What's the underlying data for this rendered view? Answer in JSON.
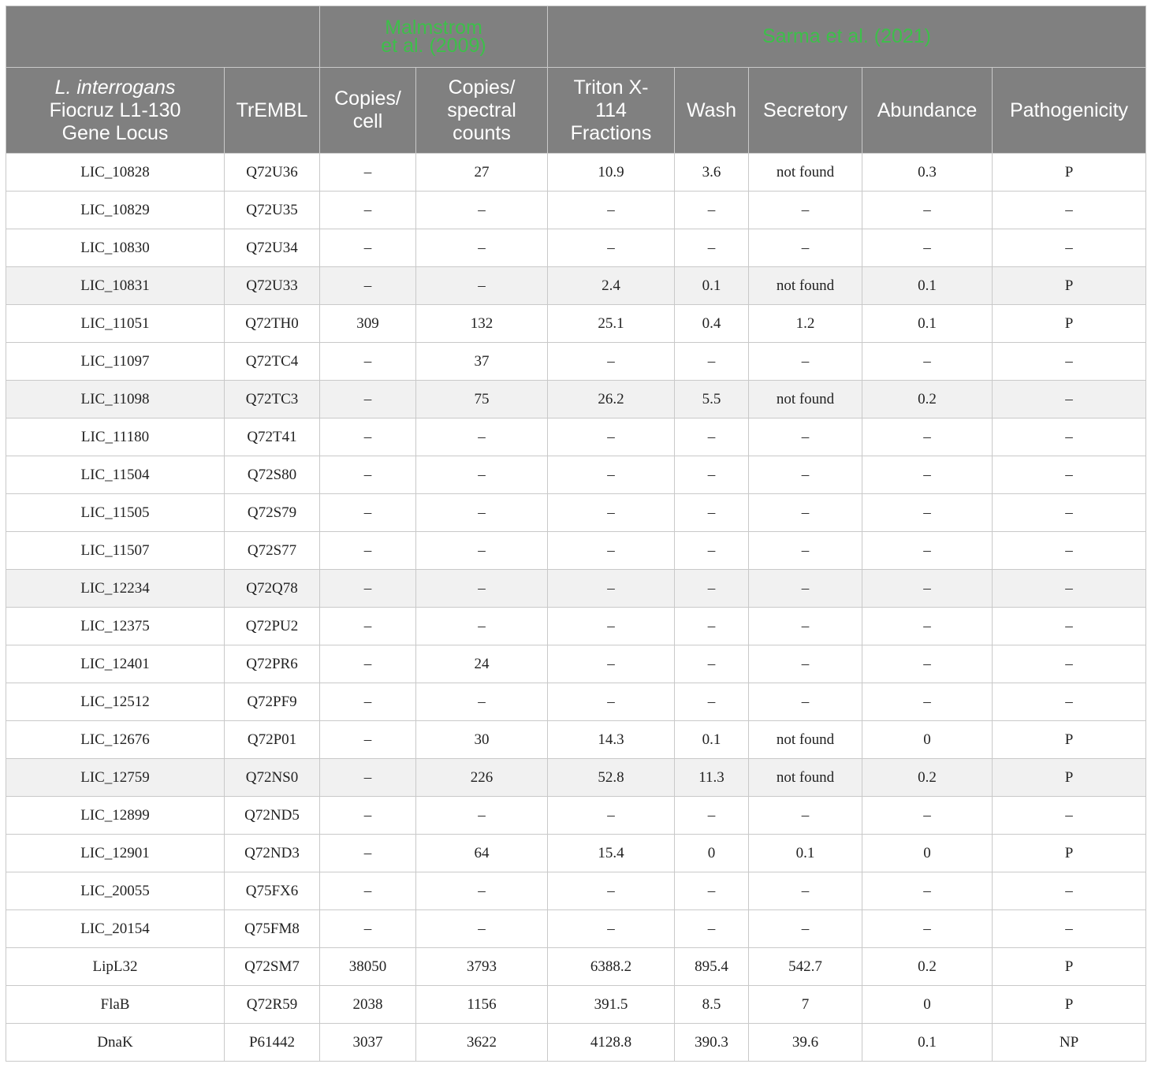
{
  "group_headers": {
    "blank": "",
    "malmstrom_line1": "Malmstrom",
    "malmstrom_line2": "et al. (2009)",
    "sarma": "Sarma et al. (2021)"
  },
  "columns": {
    "locus": [
      "L. interrogans",
      "Fiocruz L1-130",
      "Gene Locus"
    ],
    "trembl": "TrEMBL",
    "copies_cell": [
      "Copies/",
      "cell"
    ],
    "copies_spectral": [
      "Copies/",
      "spectral",
      "counts"
    ],
    "triton": [
      "Triton X-",
      "114",
      "Fractions"
    ],
    "wash": "Wash",
    "secretory": "Secretory",
    "abundance": "Abundance",
    "pathogenicity": "Pathogenicity"
  },
  "rows": [
    {
      "locus": "LIC_10828",
      "trembl": "Q72U36",
      "copies_cell": "–",
      "copies_spectral": "27",
      "triton": "10.9",
      "wash": "3.6",
      "secretory": "not found",
      "abundance": "0.3",
      "pathogenicity": "P",
      "shaded": false
    },
    {
      "locus": "LIC_10829",
      "trembl": "Q72U35",
      "copies_cell": "–",
      "copies_spectral": "–",
      "triton": "–",
      "wash": "–",
      "secretory": "–",
      "abundance": "–",
      "pathogenicity": "–",
      "shaded": false
    },
    {
      "locus": "LIC_10830",
      "trembl": "Q72U34",
      "copies_cell": "–",
      "copies_spectral": "–",
      "triton": "–",
      "wash": "–",
      "secretory": "–",
      "abundance": "–",
      "pathogenicity": "–",
      "shaded": false
    },
    {
      "locus": "LIC_10831",
      "trembl": "Q72U33",
      "copies_cell": "–",
      "copies_spectral": "–",
      "triton": "2.4",
      "wash": "0.1",
      "secretory": "not found",
      "abundance": "0.1",
      "pathogenicity": "P",
      "shaded": true
    },
    {
      "locus": "LIC_11051",
      "trembl": "Q72TH0",
      "copies_cell": "309",
      "copies_spectral": "132",
      "triton": "25.1",
      "wash": "0.4",
      "secretory": "1.2",
      "abundance": "0.1",
      "pathogenicity": "P",
      "shaded": false
    },
    {
      "locus": "LIC_11097",
      "trembl": "Q72TC4",
      "copies_cell": "–",
      "copies_spectral": "37",
      "triton": "–",
      "wash": "–",
      "secretory": "–",
      "abundance": "–",
      "pathogenicity": "–",
      "shaded": false
    },
    {
      "locus": "LIC_11098",
      "trembl": "Q72TC3",
      "copies_cell": "–",
      "copies_spectral": "75",
      "triton": "26.2",
      "wash": "5.5",
      "secretory": "not found",
      "abundance": "0.2",
      "pathogenicity": "–",
      "shaded": true
    },
    {
      "locus": "LIC_11180",
      "trembl": "Q72T41",
      "copies_cell": "–",
      "copies_spectral": "–",
      "triton": "–",
      "wash": "–",
      "secretory": "–",
      "abundance": "–",
      "pathogenicity": "–",
      "shaded": false
    },
    {
      "locus": "LIC_11504",
      "trembl": "Q72S80",
      "copies_cell": "–",
      "copies_spectral": "–",
      "triton": "–",
      "wash": "–",
      "secretory": "–",
      "abundance": "–",
      "pathogenicity": "–",
      "shaded": false
    },
    {
      "locus": "LIC_11505",
      "trembl": "Q72S79",
      "copies_cell": "–",
      "copies_spectral": "–",
      "triton": "–",
      "wash": "–",
      "secretory": "–",
      "abundance": "–",
      "pathogenicity": "–",
      "shaded": false
    },
    {
      "locus": "LIC_11507",
      "trembl": "Q72S77",
      "copies_cell": "–",
      "copies_spectral": "–",
      "triton": "–",
      "wash": "–",
      "secretory": "–",
      "abundance": "–",
      "pathogenicity": "–",
      "shaded": false
    },
    {
      "locus": "LIC_12234",
      "trembl": "Q72Q78",
      "copies_cell": "–",
      "copies_spectral": "–",
      "triton": "–",
      "wash": "–",
      "secretory": "–",
      "abundance": "–",
      "pathogenicity": "–",
      "shaded": true
    },
    {
      "locus": "LIC_12375",
      "trembl": "Q72PU2",
      "copies_cell": "–",
      "copies_spectral": "–",
      "triton": "–",
      "wash": "–",
      "secretory": "–",
      "abundance": "–",
      "pathogenicity": "–",
      "shaded": false
    },
    {
      "locus": "LIC_12401",
      "trembl": "Q72PR6",
      "copies_cell": "–",
      "copies_spectral": "24",
      "triton": "–",
      "wash": "–",
      "secretory": "–",
      "abundance": "–",
      "pathogenicity": "–",
      "shaded": false
    },
    {
      "locus": "LIC_12512",
      "trembl": "Q72PF9",
      "copies_cell": "–",
      "copies_spectral": "–",
      "triton": "–",
      "wash": "–",
      "secretory": "–",
      "abundance": "–",
      "pathogenicity": "–",
      "shaded": false
    },
    {
      "locus": "LIC_12676",
      "trembl": "Q72P01",
      "copies_cell": "–",
      "copies_spectral": "30",
      "triton": "14.3",
      "wash": "0.1",
      "secretory": "not found",
      "abundance": "0",
      "pathogenicity": "P",
      "shaded": false
    },
    {
      "locus": "LIC_12759",
      "trembl": "Q72NS0",
      "copies_cell": "–",
      "copies_spectral": "226",
      "triton": "52.8",
      "wash": "11.3",
      "secretory": "not found",
      "abundance": "0.2",
      "pathogenicity": "P",
      "shaded": true
    },
    {
      "locus": "LIC_12899",
      "trembl": "Q72ND5",
      "copies_cell": "–",
      "copies_spectral": "–",
      "triton": "–",
      "wash": "–",
      "secretory": "–",
      "abundance": "–",
      "pathogenicity": "–",
      "shaded": false
    },
    {
      "locus": "LIC_12901",
      "trembl": "Q72ND3",
      "copies_cell": "–",
      "copies_spectral": "64",
      "triton": "15.4",
      "wash": "0",
      "secretory": "0.1",
      "abundance": "0",
      "pathogenicity": "P",
      "shaded": false
    },
    {
      "locus": "LIC_20055",
      "trembl": "Q75FX6",
      "copies_cell": "–",
      "copies_spectral": "–",
      "triton": "–",
      "wash": "–",
      "secretory": "–",
      "abundance": "–",
      "pathogenicity": "–",
      "shaded": false
    },
    {
      "locus": "LIC_20154",
      "trembl": "Q75FM8",
      "copies_cell": "–",
      "copies_spectral": "–",
      "triton": "–",
      "wash": "–",
      "secretory": "–",
      "abundance": "–",
      "pathogenicity": "–",
      "shaded": false
    },
    {
      "locus": "LipL32",
      "trembl": "Q72SM7",
      "copies_cell": "38050",
      "copies_spectral": "3793",
      "triton": "6388.2",
      "wash": "895.4",
      "secretory": "542.7",
      "abundance": "0.2",
      "pathogenicity": "P",
      "shaded": false
    },
    {
      "locus": "FlaB",
      "trembl": "Q72R59",
      "copies_cell": "2038",
      "copies_spectral": "1156",
      "triton": "391.5",
      "wash": "8.5",
      "secretory": "7",
      "abundance": "0",
      "pathogenicity": "P",
      "shaded": false
    },
    {
      "locus": "DnaK",
      "trembl": "P61442",
      "copies_cell": "3037",
      "copies_spectral": "3622",
      "triton": "4128.8",
      "wash": "390.3",
      "secretory": "39.6",
      "abundance": "0.1",
      "pathogenicity": "NP",
      "shaded": false
    }
  ]
}
